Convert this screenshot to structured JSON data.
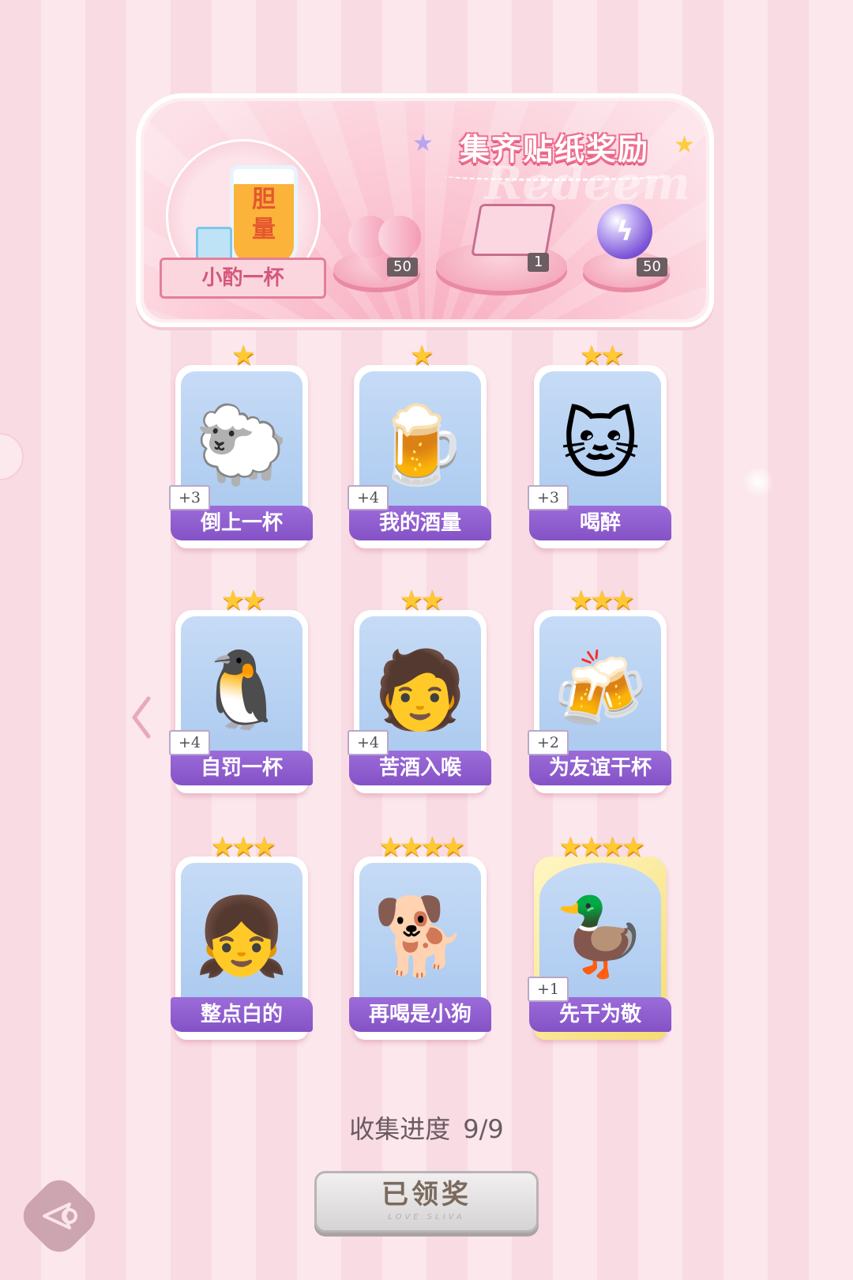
{
  "header": {
    "title": "集齐贴纸奖励",
    "watermark": "Redeem",
    "main_reward": {
      "badge_line1": "胆",
      "badge_line2": "量",
      "label": "小酌一杯"
    },
    "rewards": [
      {
        "icon": "pink-heart-gem-icon",
        "qty": "50"
      },
      {
        "icon": "gift-box-icon",
        "qty": "1"
      },
      {
        "icon": "purple-energy-orb-icon",
        "qty": "50"
      }
    ]
  },
  "stickers": [
    {
      "stars": "★",
      "label": "倒上一杯",
      "bonus": "+3",
      "art": "🐑"
    },
    {
      "stars": "★",
      "label": "我的酒量",
      "bonus": "+4",
      "art": "🍺"
    },
    {
      "stars": "★★",
      "label": "喝醉",
      "bonus": "+3",
      "art": "🐱"
    },
    {
      "stars": "★★",
      "label": "自罚一杯",
      "bonus": "+4",
      "art": "🐧"
    },
    {
      "stars": "★★",
      "label": "苦酒入喉",
      "bonus": "+4",
      "art": "🧑"
    },
    {
      "stars": "★★★",
      "label": "为友谊干杯",
      "bonus": "+2",
      "art": "🍻"
    },
    {
      "stars": "★★★",
      "label": "整点白的",
      "bonus": "",
      "art": "👧"
    },
    {
      "stars": "★★★★",
      "label": "再喝是小狗",
      "bonus": "",
      "art": "🐕"
    },
    {
      "stars": "★★★★",
      "label": "先干为敬",
      "bonus": "+1",
      "art": "🦆"
    }
  ],
  "progress": {
    "label": "收集进度",
    "value": "9/9"
  },
  "claim_button": {
    "label": "已领奖",
    "sub": "LOVE SLIVA"
  },
  "colors": {
    "label_purple": "#8a58ca",
    "star_gold": "#ffc934",
    "panel_pink": "#fbc6d3"
  }
}
